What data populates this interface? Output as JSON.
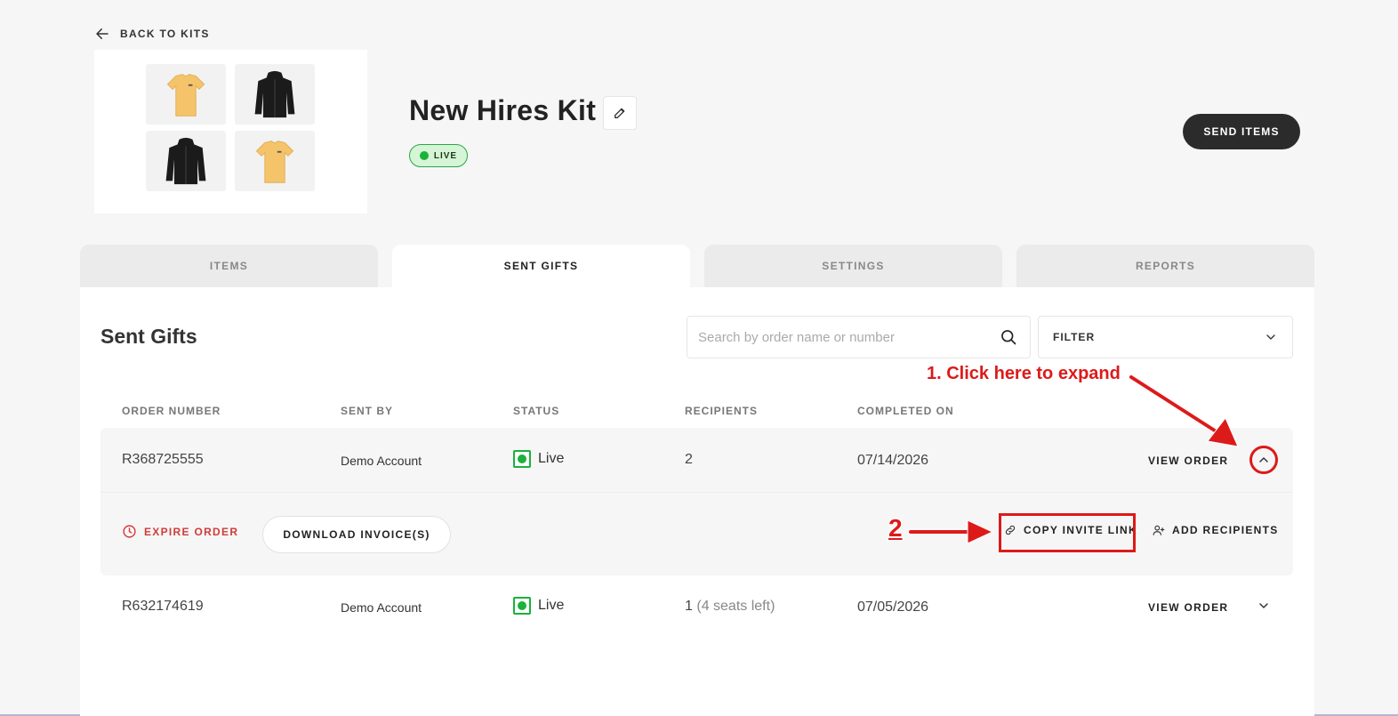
{
  "nav": {
    "back_label": "BACK TO KITS"
  },
  "kit": {
    "title": "New Hires Kit",
    "status_badge": "LIVE",
    "send_button": "SEND ITEMS"
  },
  "tabs": [
    {
      "label": "ITEMS",
      "active": false
    },
    {
      "label": "SENT GIFTS",
      "active": true
    },
    {
      "label": "SETTINGS",
      "active": false
    },
    {
      "label": "REPORTS",
      "active": false
    }
  ],
  "sent_gifts": {
    "title": "Sent Gifts",
    "search_placeholder": "Search by order name or number",
    "filter_label": "FILTER",
    "columns": [
      "ORDER NUMBER",
      "SENT BY",
      "STATUS",
      "RECIPIENTS",
      "COMPLETED ON"
    ],
    "orders": [
      {
        "order_number": "R368725555",
        "sent_by": "Demo Account",
        "status": "Live",
        "recipients": "2",
        "recipients_note": "",
        "completed_on": "07/14/2026",
        "view_label": "VIEW ORDER",
        "expanded": true
      },
      {
        "order_number": "R632174619",
        "sent_by": "Demo Account",
        "status": "Live",
        "recipients": "1",
        "recipients_note": "(4 seats left)",
        "completed_on": "07/05/2026",
        "view_label": "VIEW ORDER",
        "expanded": false
      }
    ],
    "expanded_actions": {
      "expire": "EXPIRE ORDER",
      "download": "DOWNLOAD INVOICE(S)",
      "copy_link": "COPY INVITE LINK",
      "add_recipients": "ADD RECIPIENTS"
    }
  },
  "annotations": {
    "step1": "1. Click here to expand",
    "step2": "2",
    "color": "#dd1a1a"
  },
  "colors": {
    "live_green": "#19b23b",
    "danger_red": "#d33a3a",
    "dark_button": "#2b2b2b",
    "thumb_yellow": "#f5c46a"
  },
  "icons": {
    "back": "arrow-left-icon",
    "edit": "pencil-icon",
    "search": "search-icon",
    "filter": "chevron-down-icon",
    "expire": "clock-icon",
    "copy_link": "link-icon",
    "add_recipients": "user-plus-icon"
  }
}
